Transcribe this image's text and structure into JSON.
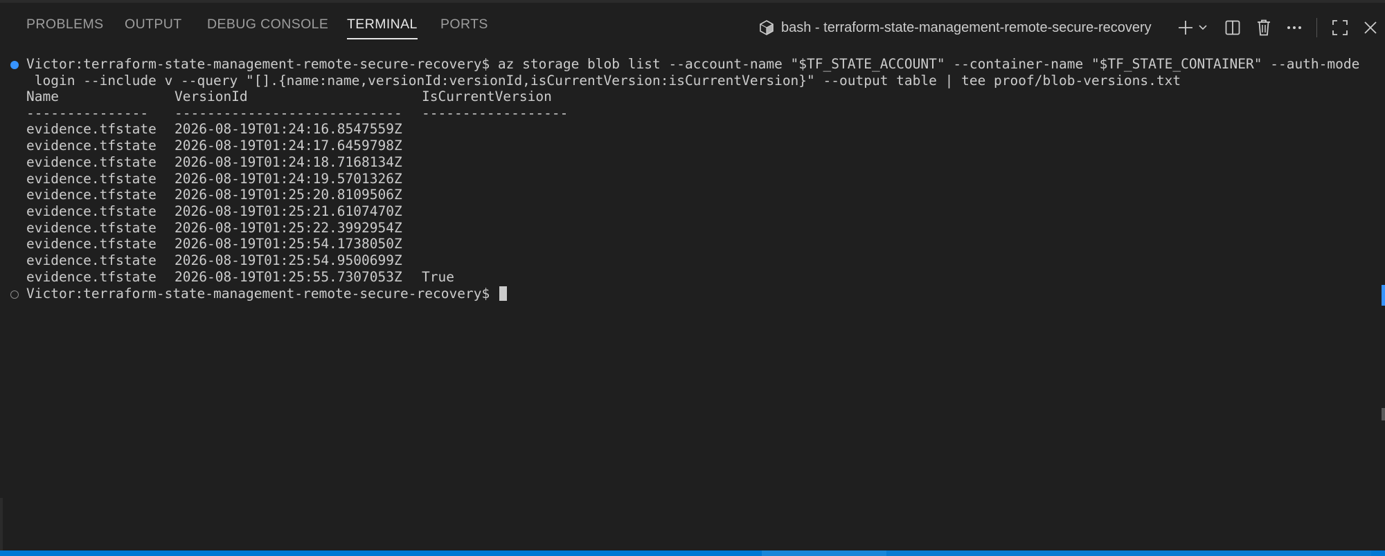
{
  "tabs": [
    {
      "label": "PROBLEMS"
    },
    {
      "label": "OUTPUT"
    },
    {
      "label": "DEBUG CONSOLE"
    },
    {
      "label": "TERMINAL",
      "active": true
    },
    {
      "label": "PORTS"
    }
  ],
  "terminal_title": "bash - terraform-state-management-remote-secure-recovery",
  "toolbar": {
    "icons": [
      "new-terminal-plus-icon",
      "chevron-down-icon",
      "split-terminal-icon",
      "trash-icon",
      "more-actions-icon",
      "maximize-panel-icon",
      "close-panel-icon"
    ]
  },
  "terminal": {
    "command_line_1": "Victor:terraform-state-management-remote-secure-recovery$ az storage blob list --account-name \"$TF_STATE_ACCOUNT\" --container-name \"$TF_STATE_CONTAINER\" --auth-mode",
    "command_line_2": " login --include v --query \"[].{name:name,versionId:versionId,isCurrentVersion:isCurrentVersion}\" --output table | tee proof/blob-versions.txt",
    "table": {
      "headers": [
        "Name",
        "VersionId",
        "IsCurrentVersion"
      ],
      "separators": [
        "---------------",
        "----------------------------",
        "------------------"
      ],
      "rows": [
        [
          "evidence.tfstate",
          "2026-08-19T01:24:16.8547559Z",
          ""
        ],
        [
          "evidence.tfstate",
          "2026-08-19T01:24:17.6459798Z",
          ""
        ],
        [
          "evidence.tfstate",
          "2026-08-19T01:24:18.7168134Z",
          ""
        ],
        [
          "evidence.tfstate",
          "2026-08-19T01:24:19.5701326Z",
          ""
        ],
        [
          "evidence.tfstate",
          "2026-08-19T01:25:20.8109506Z",
          ""
        ],
        [
          "evidence.tfstate",
          "2026-08-19T01:25:21.6107470Z",
          ""
        ],
        [
          "evidence.tfstate",
          "2026-08-19T01:25:22.3992954Z",
          ""
        ],
        [
          "evidence.tfstate",
          "2026-08-19T01:25:54.1738050Z",
          ""
        ],
        [
          "evidence.tfstate",
          "2026-08-19T01:25:54.9500699Z",
          ""
        ],
        [
          "evidence.tfstate",
          "2026-08-19T01:25:55.7307053Z",
          "True"
        ]
      ]
    },
    "prompt": "Victor:terraform-state-management-remote-secure-recovery$ "
  },
  "colors": {
    "background": "#1f1f1f",
    "accent": "#3794ff",
    "statusbar": "#0078d4"
  }
}
